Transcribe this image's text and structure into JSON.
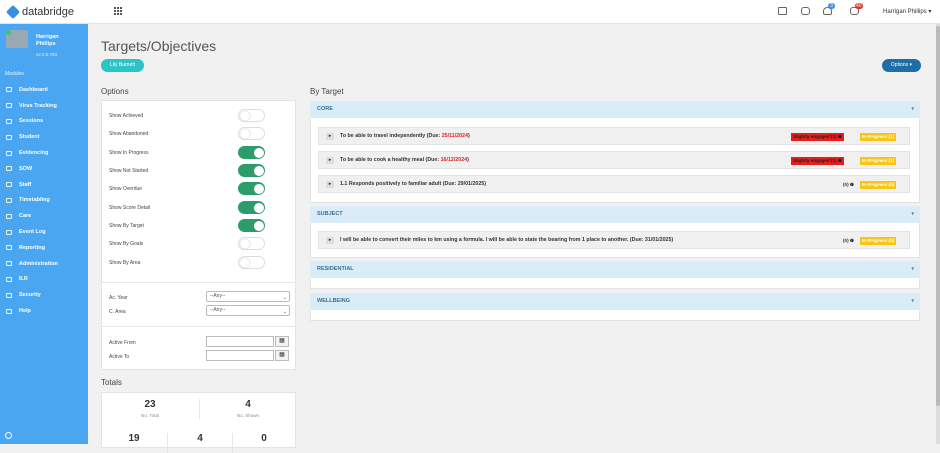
{
  "app": {
    "name": "databridge"
  },
  "topbar": {
    "user_menu": "Harrigan Phillips ▾",
    "badge_blue": "3",
    "badge_red": "40"
  },
  "sidebar": {
    "profile_name": "Harrigan Phillips",
    "profile_version": "v2.0.0.793",
    "modules_label": "Modules",
    "items": [
      {
        "label": "Dashboard"
      },
      {
        "label": "Virus Tracking"
      },
      {
        "label": "Sessions"
      },
      {
        "label": "Student"
      },
      {
        "label": "Evidencing"
      },
      {
        "label": "SOW"
      },
      {
        "label": "Staff"
      },
      {
        "label": "Timetabling"
      },
      {
        "label": "Care"
      },
      {
        "label": "Event Log"
      },
      {
        "label": "Reporting"
      },
      {
        "label": "Administration"
      },
      {
        "label": "ILR"
      },
      {
        "label": "Security"
      },
      {
        "label": "Help"
      }
    ]
  },
  "page": {
    "title": "Targets/Objectives",
    "student_pill": "Lily Burnett",
    "options_button": "Options ▾"
  },
  "options": {
    "title": "Options",
    "toggles": [
      {
        "label": "Show Achieved",
        "on": false
      },
      {
        "label": "Show Abandoned",
        "on": false
      },
      {
        "label": "Show In Progress",
        "on": true
      },
      {
        "label": "Show Not Started",
        "on": true
      },
      {
        "label": "Show Overdue",
        "on": true
      },
      {
        "label": "Show Score Detail",
        "on": true
      },
      {
        "label": "Show By Target",
        "on": true
      },
      {
        "label": "Show By Goals",
        "on": false
      },
      {
        "label": "Show By Area",
        "on": false
      }
    ],
    "ac_year_label": "Ac. Year",
    "ac_year_value": "--Any--",
    "c_area_label": "C. Area",
    "c_area_value": "--Any--",
    "active_from_label": "Active From",
    "active_to_label": "Active To"
  },
  "totals": {
    "title": "Totals",
    "total_value": "23",
    "total_label": "No. Total",
    "shown_value": "4",
    "shown_label": "No. Shown",
    "row2": [
      "19",
      "4",
      "0"
    ]
  },
  "by_target": {
    "title": "By Target",
    "categories": [
      {
        "name": "CORE",
        "targets": [
          {
            "text": "To be able to travel independently (Due: ",
            "due": "25/11/2024",
            "close": ")",
            "tag1": "Slightly engaged (1) ❶",
            "tag2": "In Progress (1)"
          },
          {
            "text": "To be able to cook a healthy meal (Due: ",
            "due": "16/12/2024",
            "close": ")",
            "tag1": "Slightly engaged (1) ❶",
            "tag2": "In Progress (1)"
          },
          {
            "text": "1.1 Responds positively to familiar adult (Due: 29/01/2025)",
            "due": "",
            "close": "",
            "tag1": "(0) ❶",
            "tag2": "In Progress (0)"
          }
        ]
      },
      {
        "name": "SUBJECT",
        "targets": [
          {
            "text": "I will be able to convert their miles to km using a formula. I will be able to state the bearing from 1 place to another. (Due: 31/01/2025)",
            "due": "",
            "close": "",
            "tag1": "(0) ❶",
            "tag2": "In Progress (0)"
          }
        ]
      },
      {
        "name": "RESIDENTIAL",
        "targets": []
      },
      {
        "name": "WELLBEING",
        "targets": []
      }
    ]
  }
}
